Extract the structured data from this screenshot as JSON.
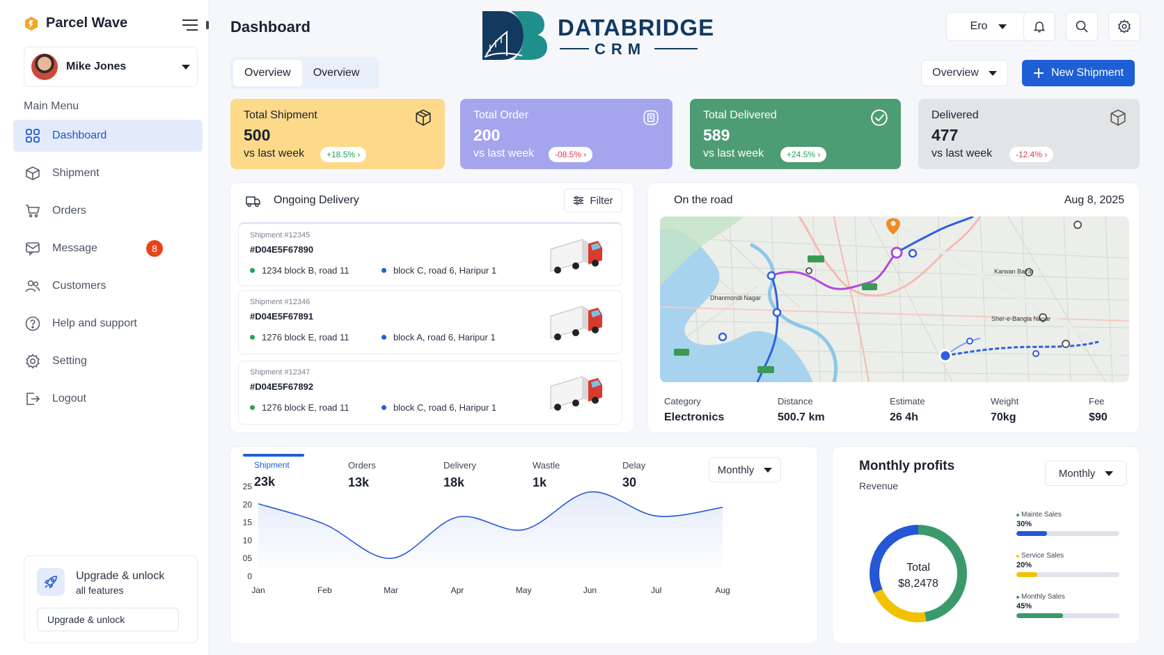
{
  "brand": {
    "name": "Parcel Wave"
  },
  "user": {
    "name": "Mike Jones"
  },
  "sidebar": {
    "section_label": "Main Menu",
    "items": [
      {
        "label": "Dashboard",
        "icon": "grid-icon"
      },
      {
        "label": "Shipment",
        "icon": "box-icon"
      },
      {
        "label": "Orders",
        "icon": "cart-icon"
      },
      {
        "label": "Message",
        "icon": "message-icon",
        "badge": "8"
      },
      {
        "label": "Customers",
        "icon": "users-icon"
      },
      {
        "label": "Help and support",
        "icon": "help-icon"
      },
      {
        "label": "Setting",
        "icon": "gear-icon"
      },
      {
        "label": "Logout",
        "icon": "logout-icon"
      }
    ],
    "upgrade": {
      "title": "Upgrade & unlock",
      "subtitle": "all features",
      "button": "Upgrade & unlock"
    }
  },
  "header": {
    "title": "Dashboard",
    "logo": {
      "word1": "DATABRIDGE",
      "word2": "CRM",
      "mark": "DB"
    },
    "region_select": "Ero",
    "tabs": [
      "Overview",
      "Overview"
    ],
    "overview_select": "Overview",
    "new_button": "New Shipment"
  },
  "stats": [
    {
      "title": "Total Shipment",
      "value": "500",
      "foot": "vs last week",
      "change": "+18.5%",
      "bg": "#fdd98a",
      "pill_color": "#23a25b"
    },
    {
      "title": "Total Order",
      "value": "200",
      "foot": "vs last week",
      "change": "-08.5%",
      "bg": "#a5a5ee",
      "pill_color": "#e0374a"
    },
    {
      "title": "Total Delivered",
      "value": "589",
      "foot": "vs last week",
      "change": "+24.5%",
      "bg": "#4e9c73",
      "pill_color": "#23a25b"
    },
    {
      "title": "Delivered",
      "value": "477",
      "foot": "vs last week",
      "change": "-12.4%",
      "bg": "#e3e4e6",
      "pill_color": "#e0374a"
    }
  ],
  "ongoing": {
    "title": "Ongoing Delivery",
    "filter": "Filter",
    "shipments": [
      {
        "id": "Shipment #12345",
        "code": "#D04E5F67890",
        "from": "1234 block B, road 11",
        "to": "block C, road 6, Haripur 1"
      },
      {
        "id": "Shipment #12346",
        "code": "#D04E5F67891",
        "from": "1276 block E, road 11",
        "to": "block A, road 6, Haripur 1"
      },
      {
        "id": "Shipment #12347",
        "code": "#D04E5F67892",
        "from": "1276 block E, road 11",
        "to": "block C, road 6, Haripur 1"
      }
    ]
  },
  "road": {
    "title": "On the road",
    "date": "Aug 8, 2025",
    "map_labels": {
      "dhanmondi": "Dhanmondi Nagar",
      "karwan": "Karwan Bazar",
      "sher": "Sher-e-Bangla Nagar"
    },
    "metrics": [
      {
        "label": "Category",
        "value": "Electronics"
      },
      {
        "label": "Distance",
        "value": "500.7 km"
      },
      {
        "label": "Estimate",
        "value": "26 4h"
      },
      {
        "label": "Weight",
        "value": "70kg"
      },
      {
        "label": "Fee",
        "value": "$90"
      }
    ]
  },
  "performance": {
    "kpis": [
      {
        "label": "Shipment",
        "value": "23k"
      },
      {
        "label": "Orders",
        "value": "13k"
      },
      {
        "label": "Delivery",
        "value": "18k"
      },
      {
        "label": "Wastle",
        "value": "1k"
      },
      {
        "label": "Delay",
        "value": "30"
      }
    ],
    "period_select": "Monthly"
  },
  "chart_data": {
    "type": "line",
    "categories": [
      "Jan",
      "Feb",
      "Mar",
      "Apr",
      "May",
      "Jun",
      "Jul",
      "Aug"
    ],
    "series": [
      {
        "values": [
          20.2,
          14.5,
          5,
          16.5,
          13,
          23.5,
          16.8,
          19.2
        ]
      }
    ],
    "y_ticks": [
      "0",
      "05",
      "10",
      "15",
      "20",
      "25"
    ],
    "ylim": [
      0,
      25
    ],
    "color": "#2457d6"
  },
  "profits": {
    "title": "Monthly profits",
    "subtitle": "Revenue",
    "period_select": "Monthly",
    "total_label": "Total",
    "total_value": "$8,2478",
    "segments": [
      {
        "name": "Mainte Sales",
        "pct_text": "30%",
        "value": 30,
        "color": "#2457d6"
      },
      {
        "name": "Service Sales",
        "pct_text": "20%",
        "value": 20,
        "color": "#f2c200"
      },
      {
        "name": "Monthly Sales",
        "pct_text": "45%",
        "value": 45,
        "color": "#3a9a6c"
      }
    ]
  }
}
